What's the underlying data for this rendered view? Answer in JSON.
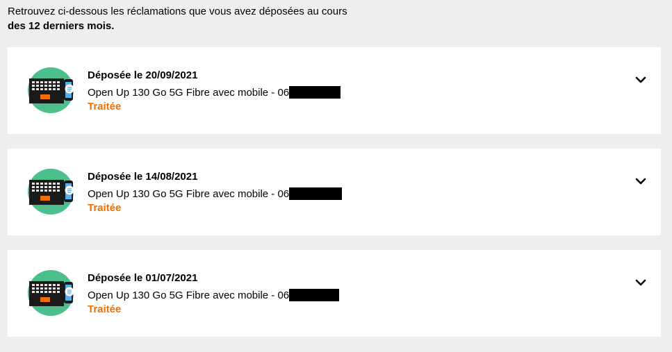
{
  "intro": {
    "line1": "Retrouvez ci-dessous les réclamations que vous avez déposées au cours",
    "line2": "des 12 derniers mois."
  },
  "claims": [
    {
      "title": "Déposée le 20/09/2021",
      "offer": "Open Up 130 Go 5G Fibre avec mobile - 06",
      "status": "Traitée"
    },
    {
      "title": "Déposée le 14/08/2021",
      "offer": "Open Up 130 Go 5G Fibre avec mobile - 06",
      "status": "Traitée"
    },
    {
      "title": "Déposée le 01/07/2021",
      "offer": "Open Up 130 Go 5G Fibre avec mobile - 06",
      "status": "Traitée"
    }
  ],
  "icons": {
    "avatar": "laptop-phone-chat-illustration",
    "expand": "chevron-down-icon"
  },
  "colors": {
    "status": "#f16e00",
    "avatar_bg": "#4dbf8c",
    "background": "#eeeeee"
  }
}
